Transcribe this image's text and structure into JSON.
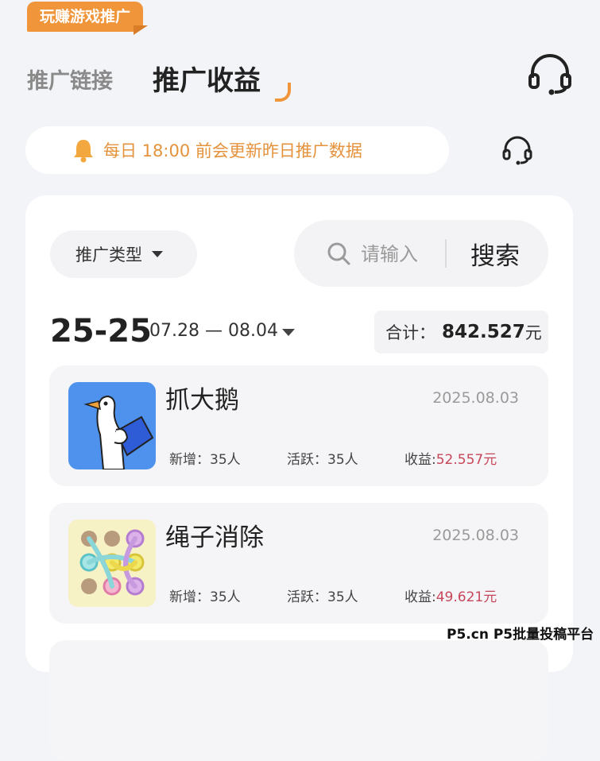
{
  "badge": {
    "label": "玩赚游戏推广"
  },
  "tabs": {
    "link": "推广链接",
    "income": "推广收益"
  },
  "notice": {
    "text": "每日 18:00 前会更新昨日推广数据",
    "icon": "bell-icon"
  },
  "filter": {
    "type_label": "推广类型"
  },
  "search": {
    "placeholder": "请输入",
    "button": "搜索"
  },
  "period": {
    "label": "25-25",
    "range": "07.28 — 08.04"
  },
  "total": {
    "label": "合计：",
    "value": "842.527",
    "unit": "元"
  },
  "items": [
    {
      "name": "抓大鹅",
      "date": "2025.08.03",
      "new_label": "新增：35人",
      "active_label": "活跃：35人",
      "income_label": "收益:",
      "income_value": "52.557元",
      "icon": "goose-game-icon"
    },
    {
      "name": "绳子消除",
      "date": "2025.08.03",
      "new_label": "新增：35人",
      "active_label": "活跃：35人",
      "income_label": "收益:",
      "income_value": "49.621元",
      "icon": "rope-game-icon"
    }
  ],
  "watermark": "P5.cn P5批量投稿平台",
  "colors": {
    "accent": "#f0953a",
    "notice_text": "#e5923c",
    "income_red": "#c8465a"
  }
}
